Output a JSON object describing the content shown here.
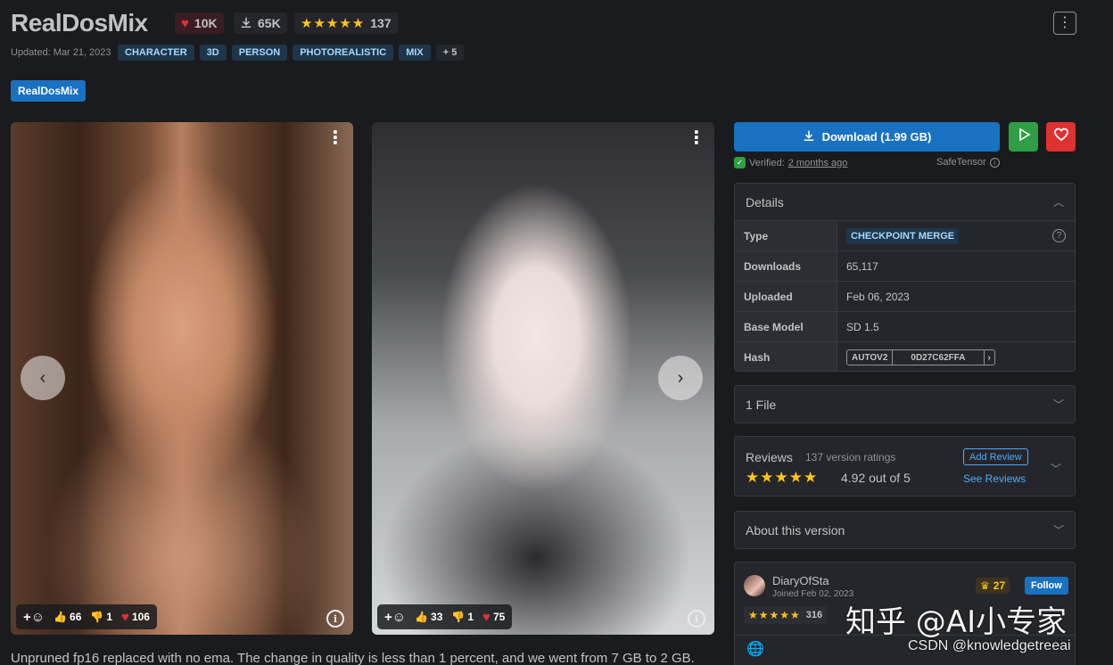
{
  "model": {
    "title": "RealDosMix",
    "likes": "10K",
    "downloads": "65K",
    "rating_stars": "★★★★★",
    "rating_count": "137",
    "updated": "Updated: Mar 21, 2023",
    "tags": [
      "CHARACTER",
      "3D",
      "PERSON",
      "PHOTOREALISTIC",
      "MIX",
      "+ 5"
    ],
    "version_badge": "RealDosMix"
  },
  "gallery": {
    "prev_icon": "‹",
    "next_icon": "›",
    "images": [
      {
        "likes": "66",
        "dislikes": "1",
        "hearts": "106"
      },
      {
        "likes": "33",
        "dislikes": "1",
        "hearts": "75"
      }
    ]
  },
  "description": "Unpruned fp16 replaced with no ema. The change in quality is less than 1 percent, and we went from 7 GB to 2 GB.",
  "sidebar": {
    "download_label": "Download (1.99 GB)",
    "verified_prefix": "Verified:",
    "verified_time": "2 months ago",
    "format": "SafeTensor",
    "details": {
      "header": "Details",
      "rows": [
        {
          "label": "Type",
          "value": "CHECKPOINT MERGE"
        },
        {
          "label": "Downloads",
          "value": "65,117"
        },
        {
          "label": "Uploaded",
          "value": "Feb 06, 2023"
        },
        {
          "label": "Base Model",
          "value": "SD 1.5"
        },
        {
          "label": "Hash",
          "hash_type": "AUTOV2",
          "hash_value": "0D27C62FFA"
        }
      ]
    },
    "files_label": "1 File",
    "reviews": {
      "title": "Reviews",
      "count_text": "137 version ratings",
      "stars": "★★★★★",
      "average": "4.92 out of 5",
      "add_review": "Add Review",
      "see_reviews": "See Reviews"
    },
    "about_label": "About this version",
    "creator": {
      "name": "DiaryOfSta",
      "joined": "Joined Feb 02, 2023",
      "rank": "27",
      "follow": "Follow",
      "stars": "★★★★★",
      "rating_count": "316"
    }
  },
  "watermarks": {
    "zhihu": "知乎 @AI小专家",
    "csdn": "CSDN @knowledgetreeai"
  },
  "colors": {
    "accent": "#1971c2",
    "like": "#e03131",
    "verified": "#2f9e44",
    "star": "#fcc419"
  }
}
